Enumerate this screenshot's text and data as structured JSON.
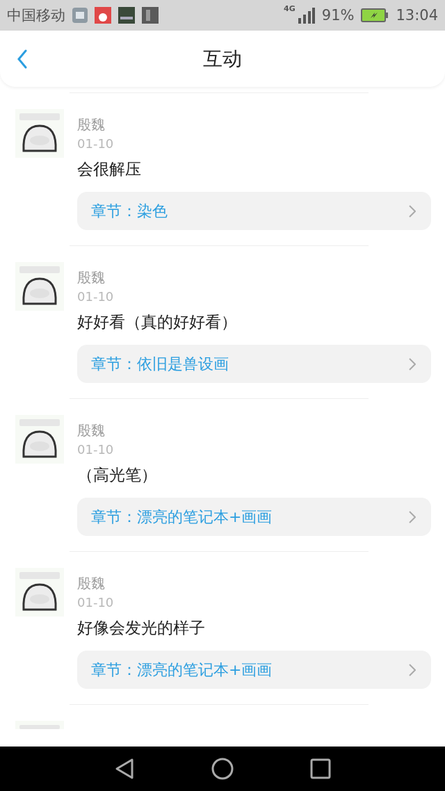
{
  "status_bar": {
    "carrier": "中国移动",
    "network": "4G",
    "battery": "91%",
    "time": "13:04"
  },
  "header": {
    "title": "互动"
  },
  "comments": [
    {
      "author": "殷魏",
      "date": "01-10",
      "text": "会很解压",
      "chapter": "章节：染色"
    },
    {
      "author": "殷魏",
      "date": "01-10",
      "text": "好好看（真的好好看）",
      "chapter": "章节：依旧是兽设画"
    },
    {
      "author": "殷魏",
      "date": "01-10",
      "text": "（高光笔）",
      "chapter": "章节：漂亮的笔记本+画画"
    },
    {
      "author": "殷魏",
      "date": "01-10",
      "text": "好像会发光的样子",
      "chapter": "章节：漂亮的笔记本+画画"
    }
  ]
}
